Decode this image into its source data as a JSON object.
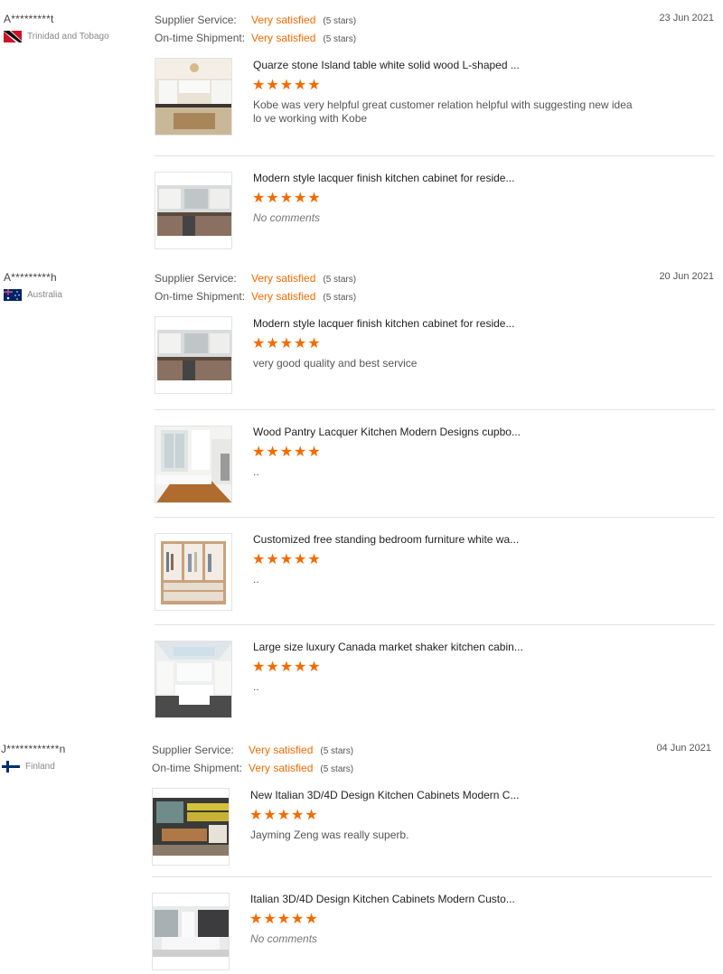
{
  "labels": {
    "supplier_service": "Supplier Service:",
    "ontime_shipment": "On-time Shipment:"
  },
  "colors": {
    "accent": "#f36b00",
    "divider": "#e2e2e2"
  },
  "reviews": [
    {
      "buyer": "A*********t",
      "country": "Trinidad and Tobago",
      "flag_icon": "trinidad-and-tobago-flag-icon",
      "supplier_service": "Very satisfied",
      "supplier_stars": "(5 stars)",
      "ontime_shipment": "Very satisfied",
      "ontime_stars": "(5 stars)",
      "date": "23 Jun 2021",
      "products": [
        {
          "title": "Quarze stone Island table white solid wood L-shaped ...",
          "rating": 5,
          "stars": "★★★★★",
          "comment": "Kobe was very helpful great customer relation helpful with suggesting new idea lo ve working with Kobe"
        },
        {
          "title": "Modern style lacquer finish kitchen cabinet for reside...",
          "rating": 5,
          "stars": "★★★★★",
          "comment": "No comments"
        }
      ]
    },
    {
      "buyer": "A*********h",
      "country": "Australia",
      "flag_icon": "australia-flag-icon",
      "supplier_service": "Very satisfied",
      "supplier_stars": "(5 stars)",
      "ontime_shipment": "Very satisfied",
      "ontime_stars": "(5 stars)",
      "date": "20 Jun 2021",
      "products": [
        {
          "title": "Modern style lacquer finish kitchen cabinet for reside...",
          "rating": 5,
          "stars": "★★★★★",
          "comment": "very good quality and best service"
        },
        {
          "title": "Wood Pantry Lacquer Kitchen Modern Designs cupbo...",
          "rating": 5,
          "stars": "★★★★★",
          "comment": ".."
        },
        {
          "title": "Customized free standing bedroom furniture white wa...",
          "rating": 5,
          "stars": "★★★★★",
          "comment": ".."
        },
        {
          "title": "Large size luxury Canada market shaker kitchen cabin...",
          "rating": 5,
          "stars": "★★★★★",
          "comment": ".."
        }
      ]
    },
    {
      "buyer": "J************n",
      "country": "Finland",
      "flag_icon": "finland-flag-icon",
      "supplier_service": "Very satisfied",
      "supplier_stars": "(5 stars)",
      "ontime_shipment": "Very satisfied",
      "ontime_stars": "(5 stars)",
      "date": "04 Jun 2021",
      "products": [
        {
          "title": "New Italian 3D/4D Design Kitchen Cabinets Modern C...",
          "rating": 5,
          "stars": "★★★★★",
          "comment": "Jayming Zeng was really superb."
        },
        {
          "title": "Italian 3D/4D Design Kitchen Cabinets Modern Custo...",
          "rating": 5,
          "stars": "★★★★★",
          "comment": "No comments"
        }
      ]
    }
  ]
}
